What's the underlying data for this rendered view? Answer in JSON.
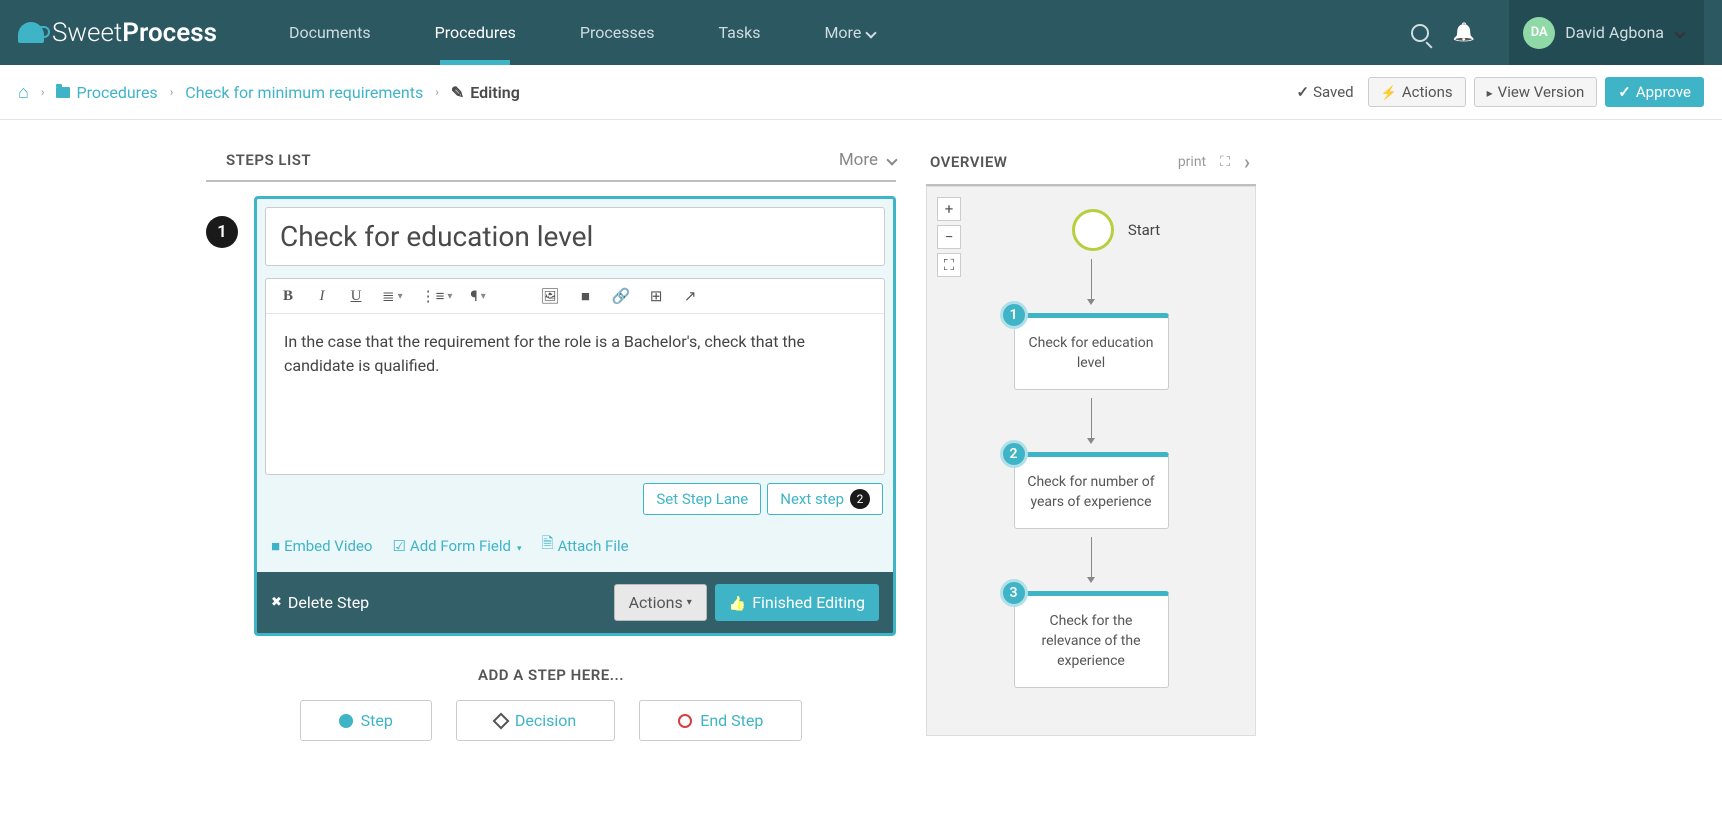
{
  "logo": {
    "prefix": "Sweet",
    "suffix": "Process"
  },
  "nav": {
    "documents": "Documents",
    "procedures": "Procedures",
    "processes": "Processes",
    "tasks": "Tasks",
    "more": "More"
  },
  "user": {
    "initials": "DA",
    "name": "David Agbona"
  },
  "breadcrumb": {
    "procedures": "Procedures",
    "item": "Check for minimum requirements",
    "current": "Editing"
  },
  "subheader": {
    "saved": "Saved",
    "actions": "Actions",
    "view_version": "View Version",
    "approve": "Approve"
  },
  "steps_list": {
    "title": "STEPS LIST",
    "more": "More"
  },
  "step": {
    "number": "1",
    "title": "Check for education level",
    "content": "In the case that the requirement for the role is a Bachelor's, check that the candidate is qualified.",
    "set_lane": "Set Step Lane",
    "next_step": "Next step",
    "next_step_count": "2",
    "embed_video": "Embed Video",
    "add_form_field": "Add Form Field",
    "attach_file": "Attach File",
    "delete": "Delete Step",
    "actions": "Actions",
    "finished": "Finished Editing"
  },
  "add_step": {
    "title": "ADD A STEP HERE...",
    "step": "Step",
    "decision": "Decision",
    "end_step": "End Step"
  },
  "overview": {
    "title": "OVERVIEW",
    "print": "print",
    "start": "Start",
    "nodes": [
      {
        "num": "1",
        "label": "Check for education level"
      },
      {
        "num": "2",
        "label": "Check for number of years of experience"
      },
      {
        "num": "3",
        "label": "Check for the relevance of the experience"
      }
    ]
  }
}
